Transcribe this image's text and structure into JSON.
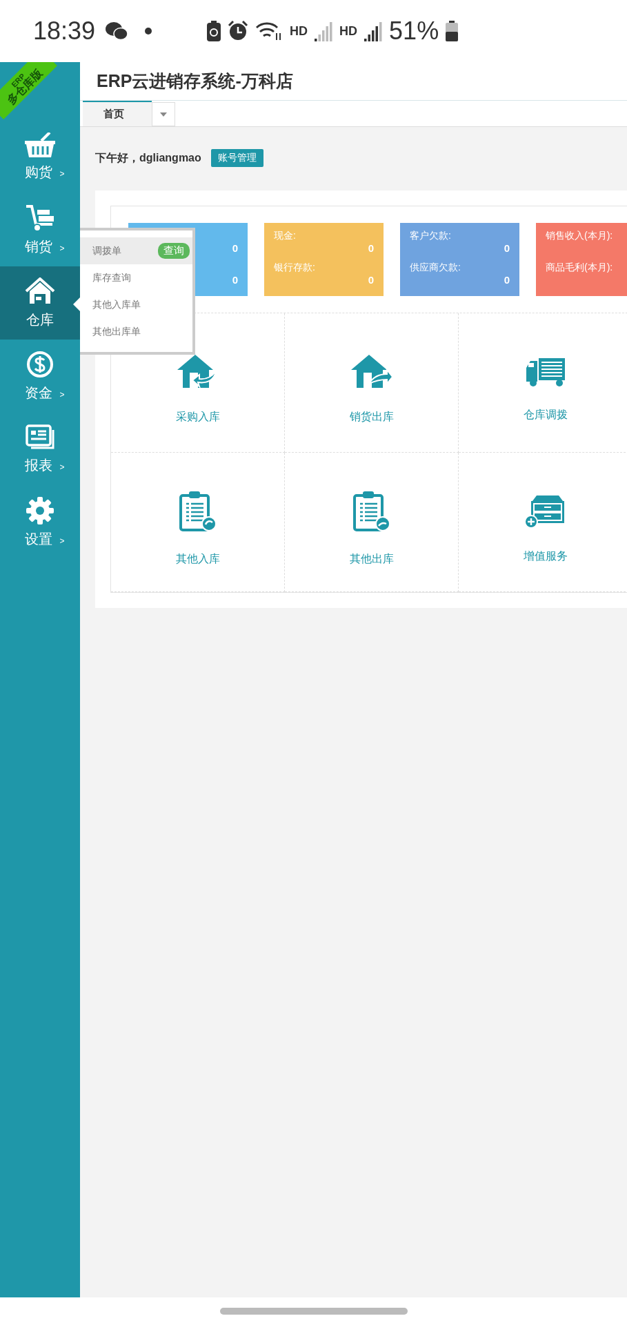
{
  "status_bar": {
    "time": "18:39",
    "signals": [
      {
        "label": "HD"
      },
      {
        "label": "HD"
      }
    ],
    "battery": "51%"
  },
  "ribbon": {
    "line_1": "ERP",
    "line_2": "多仓库版"
  },
  "window": {
    "title": "ERP云进销存系统-万科店"
  },
  "tabs": [
    {
      "label": "首页",
      "selected": true
    }
  ],
  "sidebar": {
    "items": [
      {
        "label": "购货",
        "kind": "basket",
        "arrow": ">",
        "selected": false
      },
      {
        "label": "销货",
        "kind": "cart",
        "arrow": ">",
        "selected": false
      },
      {
        "label": "仓库",
        "kind": "house",
        "selected": true
      },
      {
        "label": "资金",
        "kind": "dollar",
        "arrow": ">",
        "selected": false
      },
      {
        "label": "报表",
        "kind": "news",
        "arrow": ">",
        "selected": false
      },
      {
        "label": "设置",
        "kind": "gear",
        "arrow": ">",
        "selected": false
      }
    ]
  },
  "submenu": {
    "items": [
      {
        "label": "调拨单",
        "badge": "查询",
        "selected": true
      },
      {
        "label": "库存查询",
        "selected": false
      },
      {
        "label": "其他入库单",
        "selected": false
      },
      {
        "label": "其他出库单",
        "selected": false
      }
    ]
  },
  "greeting": "下午好，dgliangmao",
  "account_button": "账号管理",
  "cards": [
    {
      "color": "#62b9ec",
      "rows": [
        {
          "value": "0"
        },
        {
          "value": "0"
        }
      ]
    },
    {
      "color": "#f4c15d",
      "rows": [
        {
          "label": "现金:",
          "value": "0"
        },
        {
          "label": "银行存款:",
          "value": "0"
        }
      ]
    },
    {
      "color": "#6fa3df",
      "rows": [
        {
          "label": "客户欠款:",
          "value": "0"
        },
        {
          "label": "供应商欠款:",
          "value": "0"
        }
      ]
    },
    {
      "color": "#f47968",
      "rows": [
        {
          "label": "销售收入(本月):"
        },
        {
          "label": "商品毛利(本月):"
        }
      ]
    }
  ],
  "shortcuts": [
    {
      "label": "采购入库",
      "kind": "housein"
    },
    {
      "label": "销货出库",
      "kind": "houseout"
    },
    {
      "label": "仓库调拨",
      "kind": "truck"
    },
    {
      "label": "其他入库",
      "kind": "clipin"
    },
    {
      "label": "其他出库",
      "kind": "clipout"
    },
    {
      "label": "增值服务",
      "kind": "cabinet"
    }
  ]
}
